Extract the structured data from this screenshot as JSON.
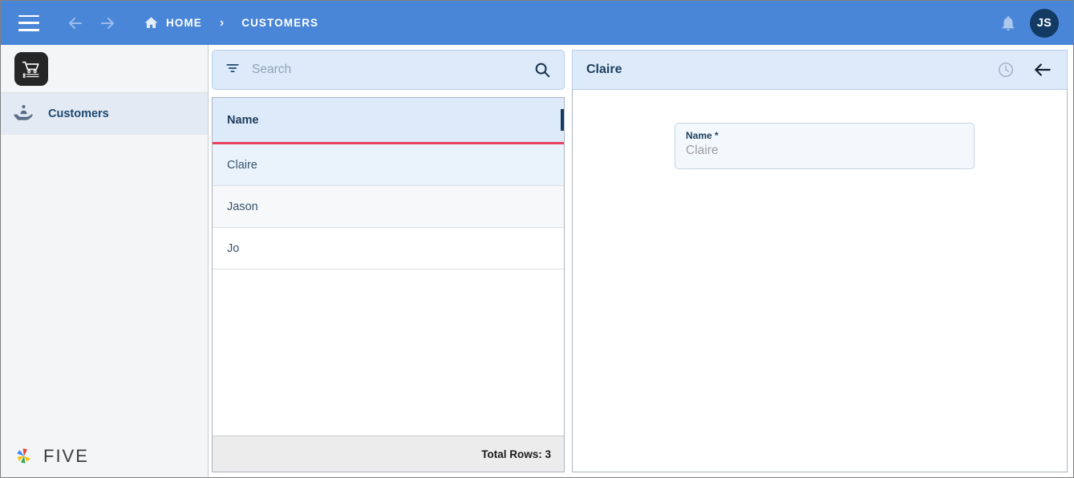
{
  "topbar": {
    "menu_icon": "hamburger-icon",
    "back_icon": "arrow-left-icon",
    "forward_icon": "arrow-right-icon",
    "home_icon": "home-icon",
    "breadcrumb_home": "HOME",
    "breadcrumb_separator": "›",
    "breadcrumb_current": "CUSTOMERS",
    "notification_icon": "bell-icon",
    "avatar_initials": "JS",
    "background_color": "#4a86d8",
    "avatar_color": "#123a63"
  },
  "sidebar": {
    "logo_icon": "shopping-cart-icon",
    "items": [
      {
        "label": "Customers",
        "icon": "customer-support-icon",
        "selected": true
      }
    ],
    "footer_logo_text": "FIVE",
    "footer_logo_icon": "five-pinwheel-icon"
  },
  "list_panel": {
    "search": {
      "filter_icon": "filter-icon",
      "placeholder": "Search",
      "value": "",
      "search_icon": "search-icon"
    },
    "columns": [
      "Name"
    ],
    "rows": [
      {
        "name": "Claire",
        "selected": true
      },
      {
        "name": "Jason",
        "selected": false
      },
      {
        "name": "Jo",
        "selected": false
      }
    ],
    "footer_total": "Total Rows: 3",
    "header_underline_color": "#e8415e"
  },
  "detail_panel": {
    "title": "Claire",
    "history_icon": "clock-history-icon",
    "back_icon": "arrow-left-icon",
    "fields": [
      {
        "label": "Name *",
        "value": "Claire"
      }
    ]
  }
}
